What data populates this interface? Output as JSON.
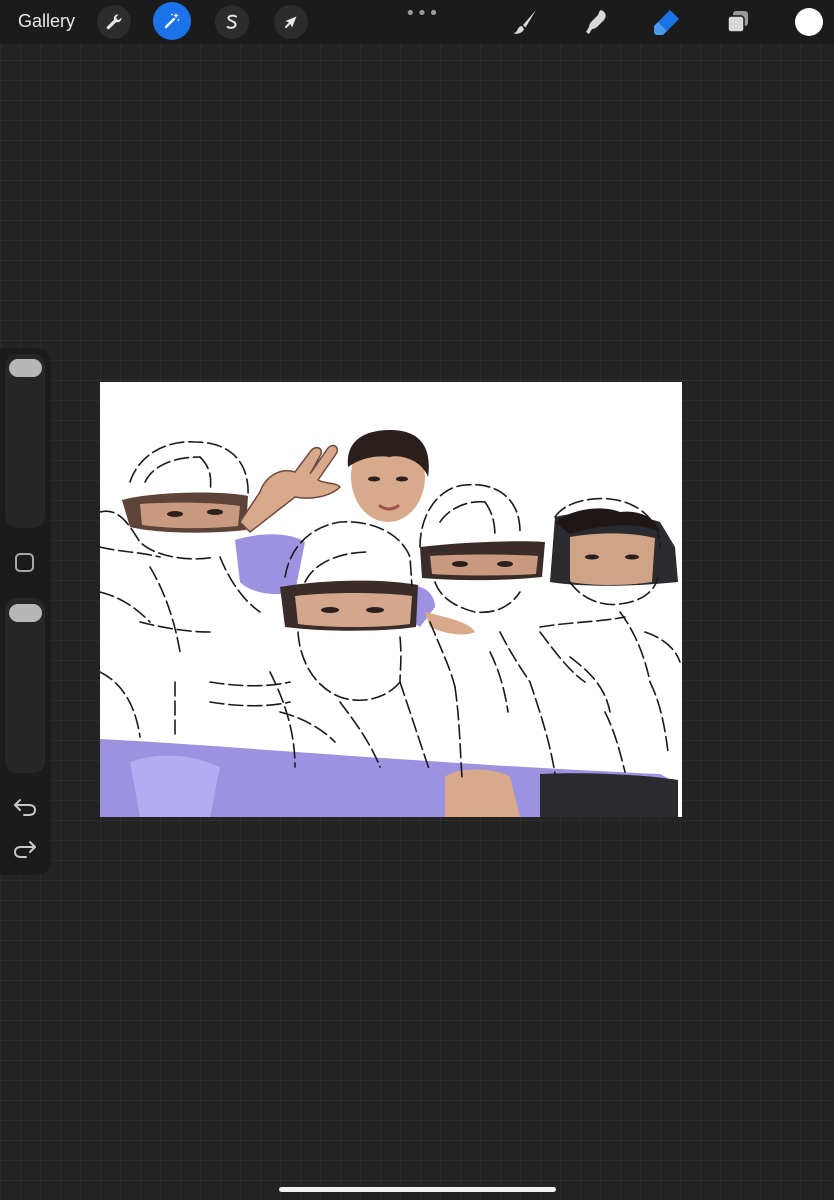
{
  "toolbar": {
    "gallery_label": "Gallery",
    "left_tools": [
      {
        "name": "actions",
        "icon": "wrench-icon"
      },
      {
        "name": "adjustments",
        "icon": "magic-wand-icon",
        "active": true
      },
      {
        "name": "selection",
        "icon": "selection-s-icon"
      },
      {
        "name": "transform",
        "icon": "arrow-cursor-icon"
      }
    ],
    "more_label": "•••",
    "right_tools": [
      {
        "name": "brush",
        "icon": "brush-icon"
      },
      {
        "name": "smudge",
        "icon": "smudge-icon"
      },
      {
        "name": "eraser",
        "icon": "eraser-icon",
        "active": true
      },
      {
        "name": "layers",
        "icon": "layers-icon"
      }
    ],
    "current_color": "#ffffff",
    "accent_color": "#1a73e8"
  },
  "sidebar": {
    "brush_size_level": 0.0,
    "brush_opacity_level": 0.0,
    "modifier_icon": "square-modifier-icon",
    "undo_icon": "undo-icon",
    "redo_icon": "redo-icon"
  },
  "canvas": {
    "background": "#ffffff",
    "shirt_color": "#9c92e0",
    "skin_color": "#d9a98c",
    "hair_color": "#2a1f1d"
  }
}
